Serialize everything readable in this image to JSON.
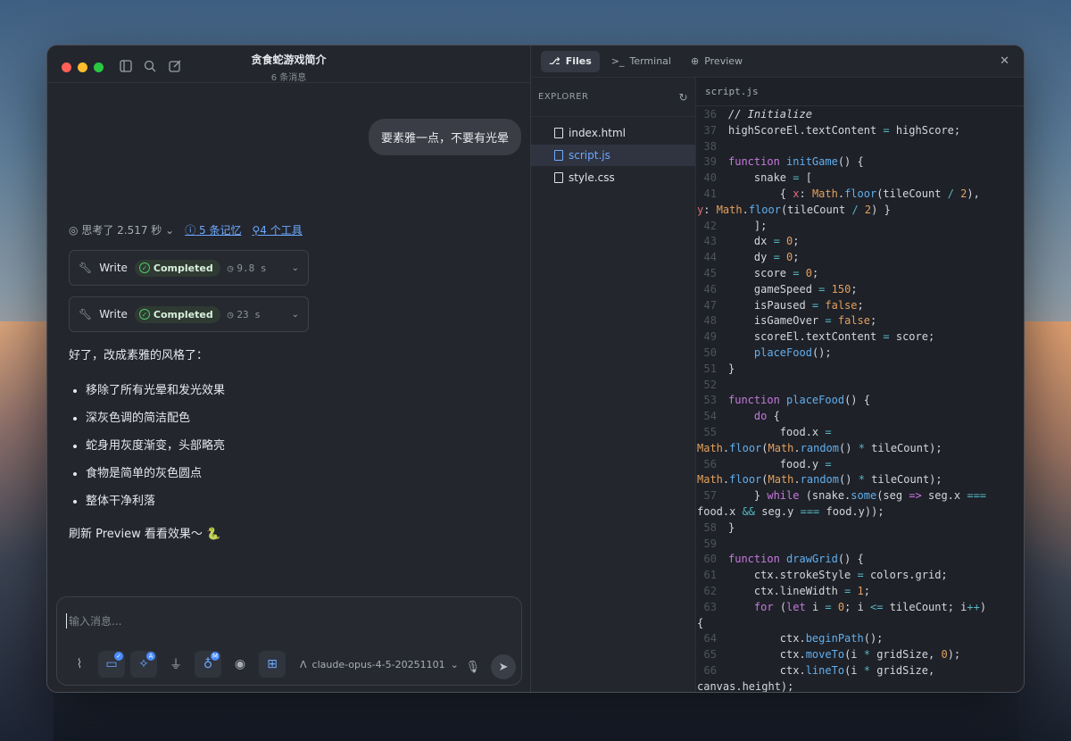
{
  "window": {
    "title": "贪食蛇游戏简介",
    "subtitle": "6 条消息"
  },
  "chat": {
    "user_message": "要素雅一点，不要有光晕",
    "meta": {
      "thinking": "思考了 2.517 秒",
      "memories": "5 条记忆",
      "tools": "4 个工具"
    },
    "tool_calls": [
      {
        "name": "Write",
        "status": "Completed",
        "duration": "9.8 s"
      },
      {
        "name": "Write",
        "status": "Completed",
        "duration": "23 s"
      }
    ],
    "answer": {
      "intro": "好了，改成素雅的风格了：",
      "bullets": [
        "移除了所有光晕和发光效果",
        "深灰色调的简洁配色",
        "蛇身用灰度渐变，头部略亮",
        "食物是简单的灰色圆点",
        "整体干净利落"
      ],
      "outro": "刷新 Preview 看看效果～ 🐍"
    },
    "composer": {
      "placeholder": "输入消息...",
      "model": "claude-opus-4-5-20251101",
      "badge_a": "A",
      "badge_m": "M"
    }
  },
  "ide": {
    "tabs": [
      {
        "label": "Files"
      },
      {
        "label": "Terminal"
      },
      {
        "label": "Preview"
      }
    ],
    "explorer_title": "EXPLORER",
    "files": [
      "index.html",
      "script.js",
      "style.css"
    ],
    "open_file": "script.js"
  }
}
